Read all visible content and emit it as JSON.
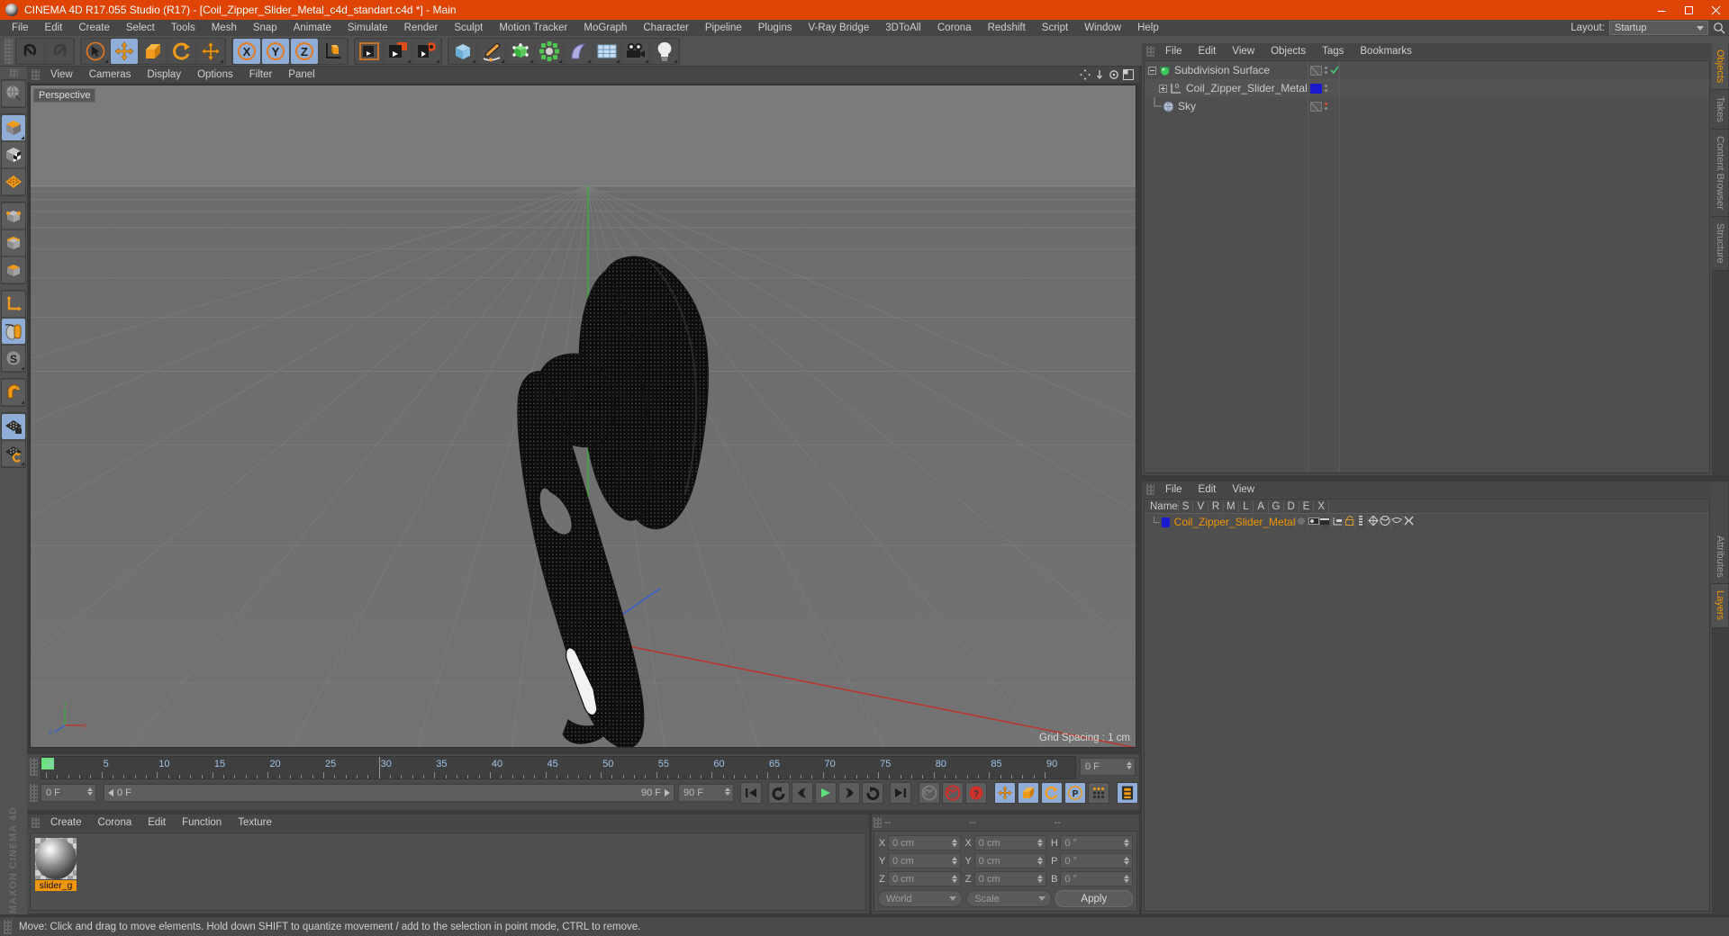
{
  "window": {
    "title": "CINEMA 4D R17.055 Studio (R17) - [Coil_Zipper_Slider_Metal_c4d_standart.c4d *] - Main",
    "minimize": "minimize-icon",
    "maximize": "maximize-icon",
    "close": "close-icon",
    "accent": "#e04403"
  },
  "menubar": {
    "items": [
      "File",
      "Edit",
      "Create",
      "Select",
      "Tools",
      "Mesh",
      "Snap",
      "Animate",
      "Simulate",
      "Render",
      "Sculpt",
      "Motion Tracker",
      "MoGraph",
      "Character",
      "Pipeline",
      "Plugins",
      "V-Ray Bridge",
      "3DToAll",
      "Corona",
      "Redshift",
      "Script",
      "Window",
      "Help"
    ],
    "layout_label": "Layout:",
    "layout_value": "Startup"
  },
  "toolbar": {
    "groups": [
      {
        "name": "history",
        "buttons": [
          {
            "name": "undo-button",
            "icon": "undo",
            "state": "normal"
          },
          {
            "name": "redo-button",
            "icon": "redo",
            "state": "disabled"
          }
        ]
      },
      {
        "name": "transform",
        "buttons": [
          {
            "name": "live-selection-button",
            "icon": "cursor-circle",
            "state": "normal"
          },
          {
            "name": "move-tool-button",
            "icon": "move-arrows",
            "state": "selected"
          },
          {
            "name": "scale-tool-button",
            "icon": "scale-box",
            "state": "normal"
          },
          {
            "name": "rotate-tool-button",
            "icon": "rotate-arc",
            "state": "normal"
          },
          {
            "name": "move-duplicate-button",
            "icon": "move-arrows",
            "state": "normal"
          }
        ]
      },
      {
        "name": "axis-locks",
        "buttons": [
          {
            "name": "lock-x-axis-button",
            "icon": "x-axis",
            "state": "selected"
          },
          {
            "name": "lock-y-axis-button",
            "icon": "y-axis",
            "state": "selected"
          },
          {
            "name": "lock-z-axis-button",
            "icon": "z-axis",
            "state": "selected"
          },
          {
            "name": "world-coordinates-button",
            "icon": "axis-cube",
            "state": "normal"
          }
        ]
      },
      {
        "name": "render",
        "buttons": [
          {
            "name": "render-view-button",
            "icon": "clapper",
            "state": "normal"
          },
          {
            "name": "render-to-picture-viewer-button",
            "icon": "clapper-window",
            "state": "normal"
          },
          {
            "name": "render-settings-button",
            "icon": "clapper-gear",
            "state": "normal"
          }
        ]
      },
      {
        "name": "create",
        "buttons": [
          {
            "name": "add-cube-button",
            "icon": "cube-blue",
            "state": "normal"
          },
          {
            "name": "add-spline-button",
            "icon": "pen-spline",
            "state": "normal"
          },
          {
            "name": "add-generator-button",
            "icon": "green-cube",
            "state": "normal"
          },
          {
            "name": "add-deformer-button",
            "icon": "green-array",
            "state": "normal"
          },
          {
            "name": "add-nurbs-button",
            "icon": "purple-surface",
            "state": "normal"
          },
          {
            "name": "add-scene-object-button",
            "icon": "floor-grid",
            "state": "normal"
          },
          {
            "name": "add-camera-button",
            "icon": "camera",
            "state": "normal"
          },
          {
            "name": "add-light-button",
            "icon": "light-bulb",
            "state": "normal"
          }
        ]
      }
    ]
  },
  "left_toolbar": {
    "buttons": [
      {
        "name": "selection-mode-button",
        "icon": "globe-sphere",
        "state": "normal"
      },
      {
        "name": "make-editable-button",
        "icon": "orange-cube",
        "state": "selected"
      },
      {
        "name": "model-mode-button",
        "icon": "checker-cube",
        "state": "normal"
      },
      {
        "name": "texture-mode-button",
        "icon": "orange-grid",
        "state": "normal"
      },
      {
        "name": "points-mode-button",
        "icon": "points-cube",
        "state": "normal"
      },
      {
        "name": "edges-mode-button",
        "icon": "edges-cube",
        "state": "normal"
      },
      {
        "name": "polygons-mode-button",
        "icon": "polygon-cube",
        "state": "normal"
      },
      {
        "name": "object-axis-button",
        "icon": "axis-arrows",
        "state": "normal"
      },
      {
        "name": "enable-snapping-button",
        "icon": "mouse",
        "state": "selected"
      },
      {
        "name": "smoothing-button",
        "icon": "s-circle",
        "state": "normal"
      },
      {
        "name": "magnet-button",
        "icon": "magnet",
        "state": "normal"
      },
      {
        "name": "lock-workplane-button",
        "icon": "grid-lock",
        "state": "selected"
      },
      {
        "name": "workplane-rotate-button",
        "icon": "grid-rotate",
        "state": "normal"
      }
    ],
    "brand": "MAXON CINEMA 4D"
  },
  "viewport": {
    "menu_items": [
      "View",
      "Cameras",
      "Display",
      "Options",
      "Filter",
      "Panel"
    ],
    "label": "Perspective",
    "grid_spacing": "Grid Spacing : 1 cm",
    "axis_labels": {
      "x": "X",
      "y": "Y",
      "z": "Z"
    }
  },
  "timeline": {
    "start_tick": 0,
    "end_tick": 90,
    "major_step": 5,
    "labels": [
      0,
      5,
      10,
      15,
      20,
      25,
      30,
      35,
      40,
      45,
      50,
      55,
      60,
      65,
      70,
      75,
      80,
      85,
      90
    ],
    "current_frame_field": "0 F",
    "current_frame_left": "0 F",
    "range_start": "0 F",
    "range_end": "90 F",
    "range_max": "90 F",
    "playback_buttons": [
      {
        "name": "go-to-start-button",
        "icon": "skip-start"
      },
      {
        "name": "play-backwards-button",
        "icon": "rewind-loop"
      },
      {
        "name": "previous-frame-button",
        "icon": "prev-key"
      },
      {
        "name": "play-button",
        "icon": "play"
      },
      {
        "name": "next-frame-button",
        "icon": "next-key"
      },
      {
        "name": "loop-button",
        "icon": "loop"
      },
      {
        "name": "go-to-end-button",
        "icon": "skip-end"
      }
    ],
    "record_buttons": [
      {
        "name": "record-active-objects-button",
        "icon": "key-grey"
      },
      {
        "name": "autokeying-button",
        "icon": "red-key"
      },
      {
        "name": "keyframe-selection-button",
        "icon": "red-question"
      }
    ],
    "key_toggle_buttons": [
      {
        "name": "record-position-button",
        "icon": "move-arrows",
        "state": "selected"
      },
      {
        "name": "record-scale-button",
        "icon": "scale-box",
        "state": "selected"
      },
      {
        "name": "record-rotation-button",
        "icon": "rotate-arc",
        "state": "selected"
      },
      {
        "name": "record-parameter-button",
        "icon": "p-circle",
        "state": "selected"
      },
      {
        "name": "record-pla-button",
        "icon": "point-dots",
        "state": "normal"
      }
    ],
    "timeline_button": {
      "name": "open-timeline-button",
      "icon": "film-strip"
    }
  },
  "material_manager": {
    "menu_items": [
      "Create",
      "Corona",
      "Edit",
      "Function",
      "Texture"
    ],
    "materials": [
      {
        "name": "slider_g"
      }
    ]
  },
  "coordinates": {
    "headers": [
      "--",
      "--",
      "--"
    ],
    "rows": [
      {
        "pos_label": "X",
        "pos_value": "0 cm",
        "size_label": "X",
        "size_value": "0 cm",
        "rot_label": "H",
        "rot_value": "0 °"
      },
      {
        "pos_label": "Y",
        "pos_value": "0 cm",
        "size_label": "Y",
        "size_value": "0 cm",
        "rot_label": "P",
        "rot_value": "0 °"
      },
      {
        "pos_label": "Z",
        "pos_value": "0 cm",
        "size_label": "Z",
        "size_value": "0 cm",
        "rot_label": "B",
        "rot_value": "0 °"
      }
    ],
    "system": "World",
    "mode": "Scale",
    "apply": "Apply"
  },
  "object_manager": {
    "menu_items": [
      "File",
      "Edit",
      "View",
      "Objects",
      "Tags",
      "Bookmarks"
    ],
    "rows": [
      {
        "label": "Subdivision Surface",
        "icon": "subdivision-surface-icon",
        "depth": 0,
        "expander": "expanded",
        "tag": "check",
        "tag_color": "#3fd47a"
      },
      {
        "label": "Coil_Zipper_Slider_Metal",
        "icon": "polygon-object-icon",
        "depth": 1,
        "expander": "collapsed",
        "tag": "material",
        "tag_color": "#1a1ad0"
      },
      {
        "label": "Sky",
        "icon": "sky-icon",
        "depth": 1,
        "expander": "none",
        "tag": "dot",
        "tag_color": "#e04b2a"
      }
    ]
  },
  "layer_manager": {
    "menu_items": [
      "File",
      "Edit",
      "View"
    ],
    "columns": [
      "Name",
      "S",
      "V",
      "R",
      "M",
      "L",
      "A",
      "G",
      "D",
      "E",
      "X"
    ],
    "rows": [
      {
        "name": "Coil_Zipper_Slider_Metal",
        "color": "#1a1ad0",
        "text_color": "#ef9600"
      }
    ]
  },
  "right_tabs": {
    "top": [
      {
        "label": "Objects",
        "active": true
      },
      {
        "label": "Takes",
        "active": false
      },
      {
        "label": "Content Browser",
        "active": false
      },
      {
        "label": "Structure",
        "active": false
      }
    ],
    "bottom": [
      {
        "label": "Attributes",
        "active": false
      },
      {
        "label": "Layers",
        "active": true
      }
    ]
  },
  "statusbar": {
    "message": "Move: Click and drag to move elements. Hold down SHIFT to quantize movement / add to the selection in point mode, CTRL to remove."
  }
}
